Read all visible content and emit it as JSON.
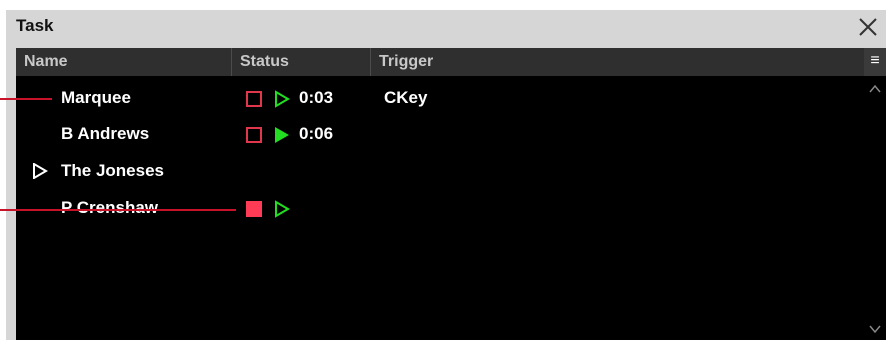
{
  "window": {
    "title": "Task"
  },
  "columns": {
    "name": "Name",
    "status": "Status",
    "trigger": "Trigger"
  },
  "menu_icon": "hamburger-menu-icon",
  "rows": [
    {
      "name": "Marquee",
      "stop": "outline",
      "play": "outline",
      "time": "0:03",
      "trigger": "CKey"
    },
    {
      "name": "B Andrews",
      "stop": "outline",
      "play": "filled",
      "time": "0:06",
      "trigger": ""
    },
    {
      "name": "The Joneses",
      "group": true
    },
    {
      "name": "P Crenshaw",
      "stop": "filled",
      "play": "outline",
      "time": "",
      "trigger": ""
    }
  ],
  "colors": {
    "stop": "#e0374d",
    "play": "#22dd22",
    "callout": "#c8122a"
  }
}
